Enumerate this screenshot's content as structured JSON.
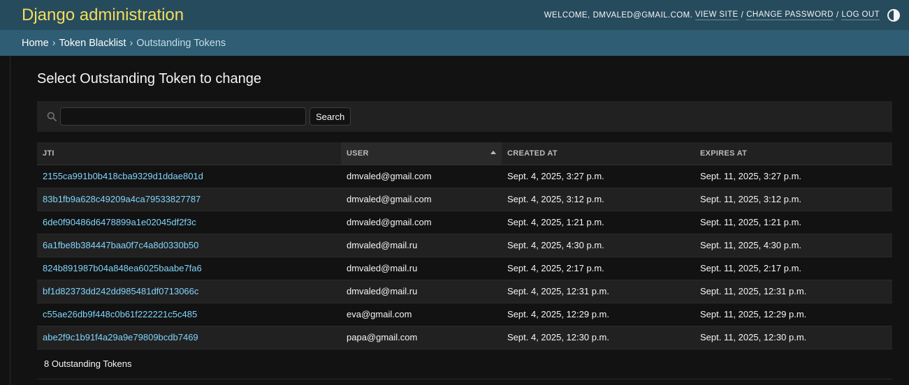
{
  "header": {
    "branding": "Django administration",
    "welcome": "Welcome,",
    "user": "dmvaled@gmail.com",
    "view_site": "View site",
    "change_password": "Change password",
    "log_out": "Log out",
    "sep": "/"
  },
  "breadcrumbs": {
    "home": "Home",
    "app": "Token Blacklist",
    "current": "Outstanding Tokens",
    "sep": "›"
  },
  "content": {
    "title": "Select Outstanding Token to change",
    "search_value": "",
    "search_button": "Search"
  },
  "table": {
    "columns": [
      "JTI",
      "User",
      "Created at",
      "Expires at"
    ],
    "rows": [
      {
        "jti": "2155ca991b0b418cba9329d1ddae801d",
        "user": "dmvaled@gmail.com",
        "created": "Sept. 4, 2025, 3:27 p.m.",
        "expires": "Sept. 11, 2025, 3:27 p.m."
      },
      {
        "jti": "83b1fb9a628c49209a4ca79533827787",
        "user": "dmvaled@gmail.com",
        "created": "Sept. 4, 2025, 3:12 p.m.",
        "expires": "Sept. 11, 2025, 3:12 p.m."
      },
      {
        "jti": "6de0f90486d6478899a1e02045df2f3c",
        "user": "dmvaled@gmail.com",
        "created": "Sept. 4, 2025, 1:21 p.m.",
        "expires": "Sept. 11, 2025, 1:21 p.m."
      },
      {
        "jti": "6a1fbe8b384447baa0f7c4a8d0330b50",
        "user": "dmvaled@mail.ru",
        "created": "Sept. 4, 2025, 4:30 p.m.",
        "expires": "Sept. 11, 2025, 4:30 p.m."
      },
      {
        "jti": "824b891987b04a848ea6025baabe7fa6",
        "user": "dmvaled@mail.ru",
        "created": "Sept. 4, 2025, 2:17 p.m.",
        "expires": "Sept. 11, 2025, 2:17 p.m."
      },
      {
        "jti": "bf1d82373dd242dd985481df0713066c",
        "user": "dmvaled@mail.ru",
        "created": "Sept. 4, 2025, 12:31 p.m.",
        "expires": "Sept. 11, 2025, 12:31 p.m."
      },
      {
        "jti": "c55ae26db9f448c0b61f222221c5c485",
        "user": "eva@gmail.com",
        "created": "Sept. 4, 2025, 12:29 p.m.",
        "expires": "Sept. 11, 2025, 12:29 p.m."
      },
      {
        "jti": "abe2f9c1b91f4a29a9e79809bcdb7469",
        "user": "papa@gmail.com",
        "created": "Sept. 4, 2025, 12:30 p.m.",
        "expires": "Sept. 11, 2025, 12:30 p.m."
      }
    ]
  },
  "paginator": "8 Outstanding Tokens",
  "icons": {
    "search": "search-icon",
    "theme": "theme-toggle-icon",
    "sort": "sort-ascending-icon"
  },
  "colors": {
    "header_bg": "#264b5d",
    "branding": "#f5dd5d",
    "link": "#81d4fa"
  }
}
